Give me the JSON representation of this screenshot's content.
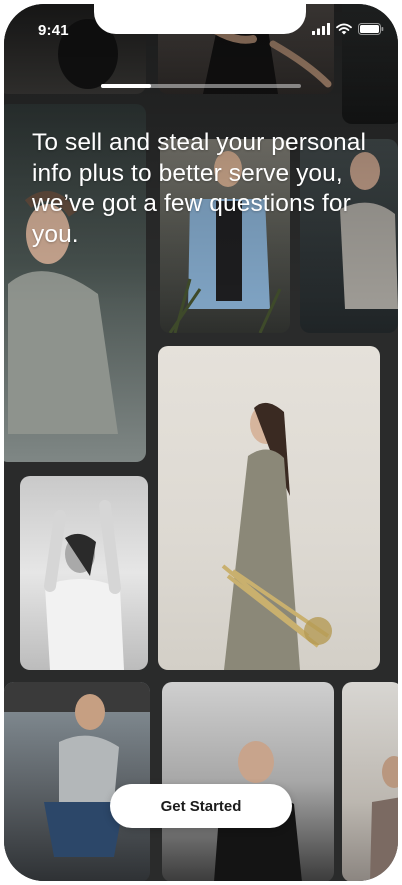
{
  "status_bar": {
    "time": "9:41",
    "icons": [
      "signal-icon",
      "wifi-icon",
      "battery-icon"
    ]
  },
  "onboarding": {
    "progress": 0.25,
    "headline": "To sell and steal your personal info plus to better serve you, we’ve got a few questions for you.",
    "cta_label": "Get Started"
  },
  "photo_grid": {
    "tiles": [
      "photo-dark-portrait",
      "photo-seated-black-dress",
      "photo-dark-corner",
      "photo-man-grey-hoodie",
      "photo-man-denim-jacket",
      "photo-woman-dark-background",
      "photo-woman-grey-dress-flowers",
      "photo-woman-white-sweater",
      "photo-man-crouching-tattoo",
      "photo-man-dark-jacket",
      "photo-partial-person"
    ]
  },
  "colors": {
    "button_bg": "#ffffff",
    "button_text": "#1c1c1c",
    "headline_text": "#ffffff",
    "notch": "#ffffff"
  }
}
